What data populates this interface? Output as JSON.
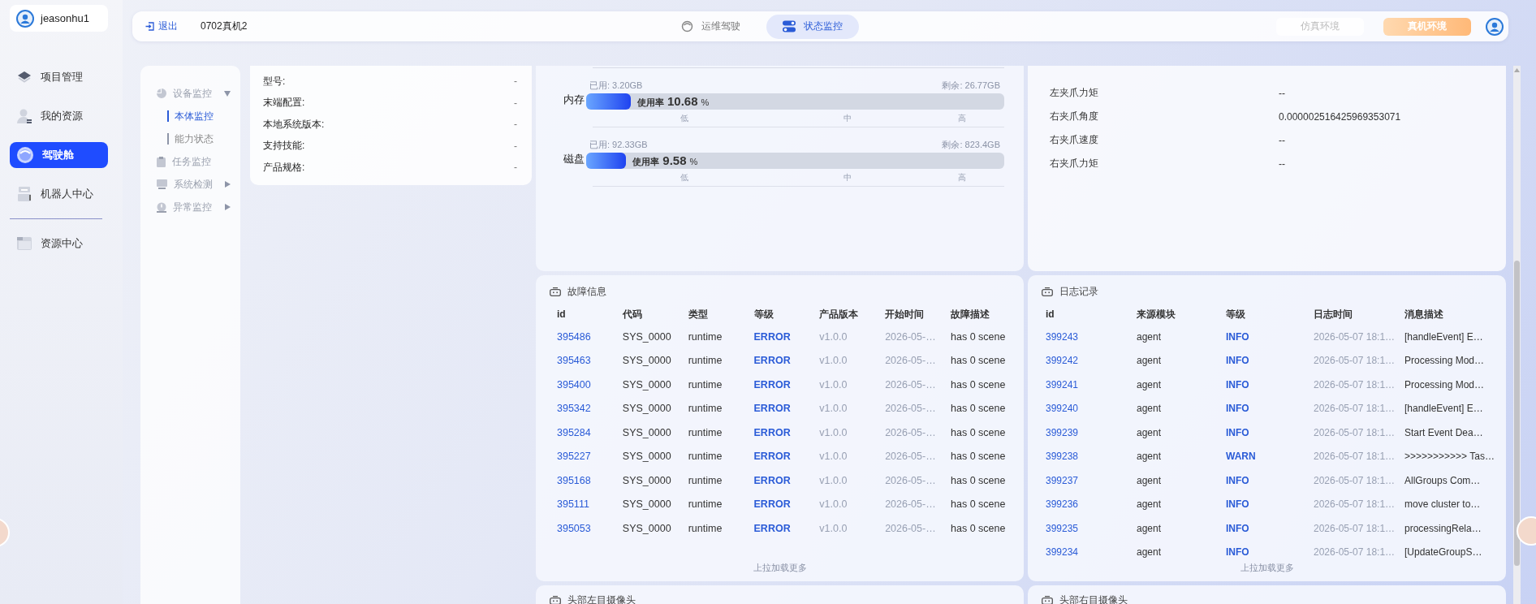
{
  "user": {
    "name": "jeasonhu1"
  },
  "sidebar": {
    "items": [
      {
        "label": "项目管理",
        "selected": false
      },
      {
        "label": "我的资源",
        "selected": false
      },
      {
        "label": "驾驶舱",
        "selected": true
      },
      {
        "label": "机器人中心",
        "selected": false
      }
    ],
    "bottom_items": [
      {
        "label": "资源中心",
        "selected": false
      }
    ]
  },
  "topbar": {
    "logout": "退出",
    "device": "0702真机2",
    "modes": [
      {
        "label": "运维驾驶",
        "selected": false
      },
      {
        "label": "状态监控",
        "selected": true
      }
    ],
    "environments": [
      {
        "label": "仿真环境",
        "selected": false
      },
      {
        "label": "真机环境",
        "selected": true
      }
    ]
  },
  "submenu": {
    "items": [
      {
        "label": "设备监控",
        "expanded": true,
        "children": [
          {
            "label": "本体监控",
            "selected": true
          },
          {
            "label": "能力状态",
            "selected": false
          }
        ]
      },
      {
        "label": "任务监控"
      },
      {
        "label": "系统检测",
        "expanded": false
      },
      {
        "label": "异常监控",
        "expanded": false
      }
    ]
  },
  "device_info": {
    "rows": [
      {
        "label": "型号:",
        "value": "-"
      },
      {
        "label": "末端配置:",
        "value": "-"
      },
      {
        "label": "本地系统版本:",
        "value": "-"
      },
      {
        "label": "支持技能:",
        "value": "-"
      },
      {
        "label": "产品规格:",
        "value": "-"
      }
    ]
  },
  "resources": {
    "items": [
      {
        "label": "内存",
        "used": "已用: 3.20GB",
        "remaining": "剩余: 26.77GB",
        "rate_label": "使用率",
        "rate": "10.68",
        "unit": "%",
        "level": 0.1068,
        "scale": [
          "低",
          "中",
          "高"
        ]
      },
      {
        "label": "磁盘",
        "used": "已用: 92.33GB",
        "remaining": "剩余: 823.4GB",
        "rate_label": "使用率",
        "rate": "9.58",
        "unit": "%",
        "level": 0.0958,
        "scale": [
          "低",
          "中",
          "高"
        ]
      }
    ]
  },
  "gripper": {
    "rows": [
      {
        "label": "左夹爪力矩",
        "value": "--"
      },
      {
        "label": "右夹爪角度",
        "value": "0.000002516425969353071"
      },
      {
        "label": "右夹爪速度",
        "value": "--"
      },
      {
        "label": "右夹爪力矩",
        "value": "--"
      }
    ]
  },
  "faults": {
    "title": "故障信息",
    "columns": [
      "id",
      "代码",
      "类型",
      "等级",
      "产品版本",
      "开始时间",
      "故障描述"
    ],
    "rows": [
      [
        "395486",
        "SYS_0000",
        "runtime",
        "ERROR",
        "v1.0.0",
        "2026-05-…",
        "has 0 scene"
      ],
      [
        "395463",
        "SYS_0000",
        "runtime",
        "ERROR",
        "v1.0.0",
        "2026-05-…",
        "has 0 scene"
      ],
      [
        "395400",
        "SYS_0000",
        "runtime",
        "ERROR",
        "v1.0.0",
        "2026-05-…",
        "has 0 scene"
      ],
      [
        "395342",
        "SYS_0000",
        "runtime",
        "ERROR",
        "v1.0.0",
        "2026-05-…",
        "has 0 scene"
      ],
      [
        "395284",
        "SYS_0000",
        "runtime",
        "ERROR",
        "v1.0.0",
        "2026-05-…",
        "has 0 scene"
      ],
      [
        "395227",
        "SYS_0000",
        "runtime",
        "ERROR",
        "v1.0.0",
        "2026-05-…",
        "has 0 scene"
      ],
      [
        "395168",
        "SYS_0000",
        "runtime",
        "ERROR",
        "v1.0.0",
        "2026-05-…",
        "has 0 scene"
      ],
      [
        "395111",
        "SYS_0000",
        "runtime",
        "ERROR",
        "v1.0.0",
        "2026-05-…",
        "has 0 scene"
      ],
      [
        "395053",
        "SYS_0000",
        "runtime",
        "ERROR",
        "v1.0.0",
        "2026-05-…",
        "has 0 scene"
      ]
    ],
    "footer": "上拉加载更多"
  },
  "logs": {
    "title": "日志记录",
    "columns": [
      "id",
      "来源模块",
      "等级",
      "日志时间",
      "消息描述"
    ],
    "rows": [
      [
        "399243",
        "agent",
        "INFO",
        "2026-05-07 18:1…",
        "[handleEvent] E…"
      ],
      [
        "399242",
        "agent",
        "INFO",
        "2026-05-07 18:1…",
        "Processing Mod…"
      ],
      [
        "399241",
        "agent",
        "INFO",
        "2026-05-07 18:1…",
        "Processing Mod…"
      ],
      [
        "399240",
        "agent",
        "INFO",
        "2026-05-07 18:1…",
        "[handleEvent] E…"
      ],
      [
        "399239",
        "agent",
        "INFO",
        "2026-05-07 18:1…",
        "Start Event Dea…"
      ],
      [
        "399238",
        "agent",
        "WARN",
        "2026-05-07 18:1…",
        ">>>>>>>>>>> Tas…"
      ],
      [
        "399237",
        "agent",
        "INFO",
        "2026-05-07 18:1…",
        "AllGroups Com…"
      ],
      [
        "399236",
        "agent",
        "INFO",
        "2026-05-07 18:1…",
        "move cluster to…"
      ],
      [
        "399235",
        "agent",
        "INFO",
        "2026-05-07 18:1…",
        "processingRela…"
      ],
      [
        "399234",
        "agent",
        "INFO",
        "2026-05-07 18:1…",
        "[UpdateGroupS…"
      ]
    ],
    "footer": "上拉加载更多"
  },
  "cameras": [
    {
      "title": "头部左目摄像头"
    },
    {
      "title": "头部右目摄像头"
    }
  ]
}
